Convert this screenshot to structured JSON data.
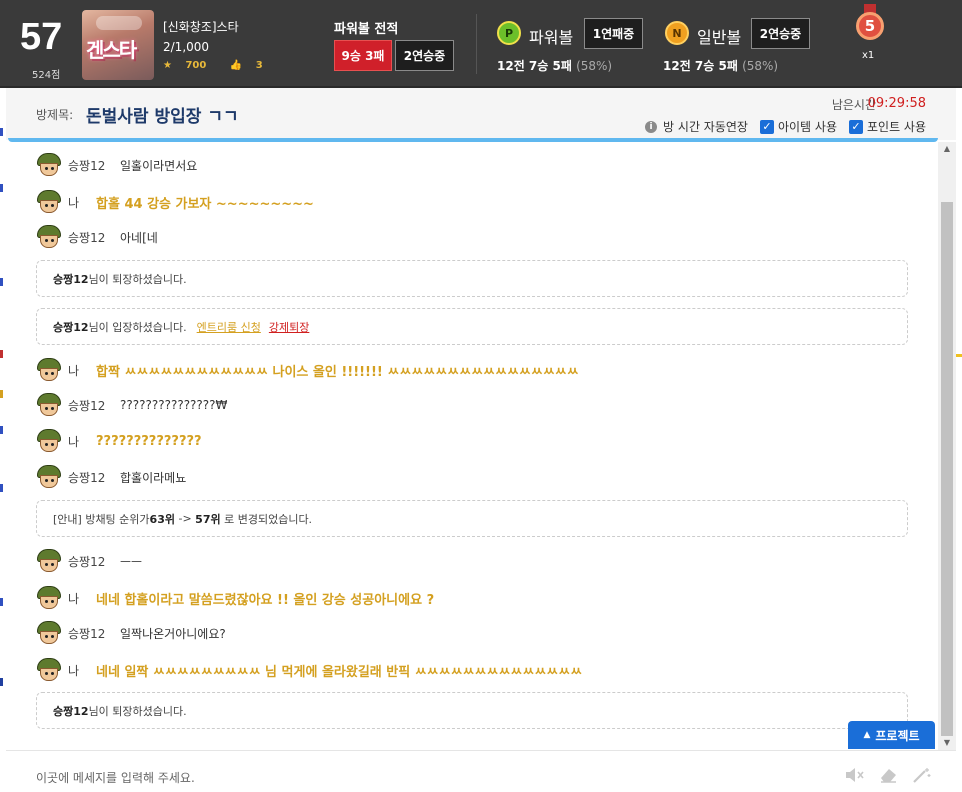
{
  "profile": {
    "level": "57",
    "score": "524점",
    "avatar_text": "겐스타",
    "nickname": "[신화창조]스타",
    "rank": "2/1,000",
    "stars": "700",
    "likes": "3"
  },
  "powerball_record": {
    "title": "파워볼 전적",
    "result": "9승 3패",
    "streak": "2연승중"
  },
  "powerball": {
    "badge": "P",
    "label": "파워볼",
    "streak": "1연패중",
    "record": "12전 7승 5패",
    "pct": "(58%)"
  },
  "normalball": {
    "badge": "N",
    "label": "일반볼",
    "streak": "2연승중",
    "record": "12전 7승 5패",
    "pct": "(58%)"
  },
  "medal": {
    "number": "5",
    "count": "x1"
  },
  "room": {
    "label": "방제목:",
    "title": "돈벌사람 방입장 ㄱㄱ",
    "time_label": "남은시간",
    "time_value": "09:29:58",
    "opt_auto": "방 시간 자동연장",
    "opt_item": "아이템 사용",
    "opt_point": "포인트 사용"
  },
  "messages": [
    {
      "type": "user",
      "nick": "승짱12",
      "text": "일홀이라면서요"
    },
    {
      "type": "me",
      "nick": "나",
      "text": "합홀 44 강승 가보자 ~~~~~~~~~"
    },
    {
      "type": "user",
      "nick": "승짱12",
      "text": "아네[네"
    },
    {
      "type": "notice",
      "bold": "승짱12",
      "text": "님이 퇴장하셨습니다."
    },
    {
      "type": "notice",
      "bold": "승짱12",
      "text": "님이 입장하셨습니다.",
      "link1": "엔트리룸 신청",
      "link2": "강제퇴장"
    },
    {
      "type": "me",
      "nick": "나",
      "text": "합짝 ㅆㅆㅆㅆㅆㅆㅆㅆㅆㅆㅆㅆ 나이스 올인 !!!!!!! ㅆㅆㅆㅆㅆㅆㅆㅆㅆㅆㅆㅆㅆㅆㅆㅆ"
    },
    {
      "type": "user",
      "nick": "승짱12",
      "text": "???????????????₩"
    },
    {
      "type": "me",
      "nick": "나",
      "text": "??????????????"
    },
    {
      "type": "user",
      "nick": "승짱12",
      "text": "합홀이라메뇨"
    },
    {
      "type": "notice",
      "pre": "[안내] 방채팅 순위가 ",
      "bold1": "63위",
      "mid": " -> ",
      "bold2": "57위",
      "text": " 로 변경되었습니다."
    },
    {
      "type": "user",
      "nick": "승짱12",
      "text": "ㅡㅡ"
    },
    {
      "type": "me",
      "nick": "나",
      "text": "네네 합홀이라고 말씀드렸잖아요 !! 올인 강승 성공아니에요 ?"
    },
    {
      "type": "user",
      "nick": "승짱12",
      "text": "일짝나온거아니에요?"
    },
    {
      "type": "me",
      "nick": "나",
      "text": "네네 일짝 ㅆㅆㅆㅆㅆㅆㅆㅆㅆ 님 먹게에 올라왔길래 반픽 ㅆㅆㅆㅆㅆㅆㅆㅆㅆㅆㅆㅆㅆㅆ"
    },
    {
      "type": "notice",
      "bold": "승짱12",
      "text": "님이 퇴장하셨습니다."
    }
  ],
  "protect_button": "프로젝트",
  "input": {
    "placeholder": "이곳에 메세지를 입력해 주세요."
  },
  "colors": {
    "header_bg": "#3a3a3a",
    "my_message": "#d4a020",
    "accent_blue": "#1a6ed8",
    "timer_red": "#d02020",
    "record_red": "#d0202a"
  }
}
